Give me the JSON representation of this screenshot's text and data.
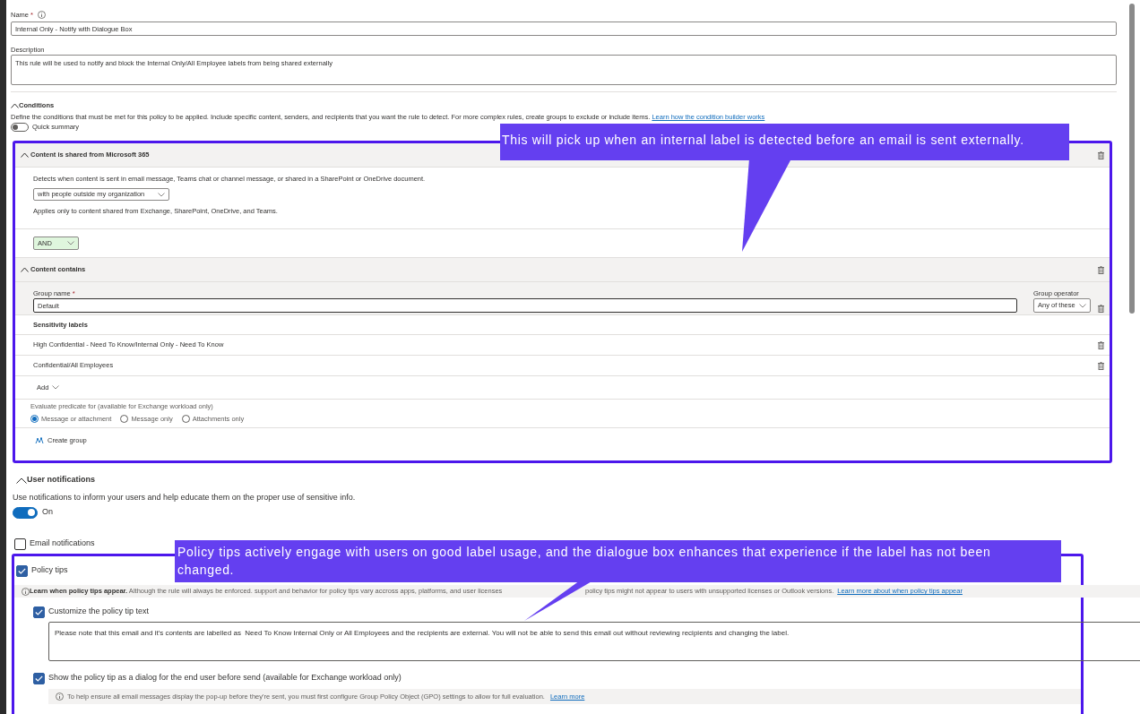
{
  "rule": {
    "name_label": "Name",
    "name_required": "*",
    "name_value": "Internal Only - Notify with Dialogue Box",
    "description_label": "Description",
    "description_value": "This rule will be used to notify and block the Internal Only/All Employee labels from being shared externally"
  },
  "conditions": {
    "title": "Conditions",
    "expanded": true,
    "text": "Define the conditions that must be met for this policy to be applied. Include specific content, senders, and recipients that you want the rule to detect. For more complex rules, create groups to exclude or include items.",
    "link": "Learn how the condition builder works",
    "quick_summary": {
      "label": "Quick summary",
      "on": false
    }
  },
  "shared_condition": {
    "title": "Content is shared from Microsoft 365",
    "expanded": true,
    "text": "Detects when content is sent in email message, Teams chat or channel message, or shared in a SharePoint or OneDrive document.",
    "dropdown": "with people outside my organization",
    "note": "Applies only to content shared from Exchange, SharePoint, OneDrive, and Teams."
  },
  "operator": "AND",
  "content_contains": {
    "title": "Content contains",
    "expanded": true,
    "group_name_label": "Group name",
    "group_name_required": "*",
    "group_name": "Default",
    "group_operator_label": "Group operator",
    "group_operator": "Any of these",
    "labels_title": "Sensitivity labels",
    "labels": [
      "High Confidential - Need To Know/Internal Only - Need To Know",
      "Confidential/All Employees"
    ],
    "add": "Add",
    "evaluate_label": "Evaluate predicate for (available for Exchange workload only)",
    "evaluate_options": [
      {
        "label": "Message or attachment",
        "selected": true
      },
      {
        "label": "Message only",
        "selected": false
      },
      {
        "label": "Attachments only",
        "selected": false
      }
    ],
    "create_group": "Create group"
  },
  "user_notifications": {
    "title": "User notifications",
    "expanded": true,
    "text": "Use notifications to inform your users and help educate them on the proper use of sensitive info.",
    "toggle": {
      "label": "On",
      "on": true
    }
  },
  "email_notifications": {
    "label": "Email notifications",
    "checked": false
  },
  "policy_tips": {
    "label": "Policy tips",
    "checked": true,
    "info": "**Learn when policy tips appear.** Although the rule will always be enforced. support and behavior for policy tips vary accross apps, platforms, and user licenses",
    "info_after": "policy tips might not appear to users with unsupported licenses or Outlook versions.",
    "info_link": "Learn more about when policy tips appear",
    "customize": {
      "label": "Customize the policy tip text",
      "checked": true
    },
    "tip_text": "Please note that this email and it's contents are labelled as  Need To Know Internal Only or All Employees and the recipients are external. You will not be able to send this email out without reviewing recipients and changing the label.",
    "dialog": {
      "label": "Show the policy tip as a dialog for the end user before send (available for Exchange workload only)",
      "checked": true
    },
    "gpo_info": "To help ensure all email messages display the pop-up before they're sent, you must first configure Group Policy Object (GPO) settings to allow for full evaluation.",
    "gpo_link": "Learn more"
  },
  "annotations": [
    {
      "text": "This will pick up when an internal label is detected before an email is sent externally."
    },
    {
      "text": "Policy tips actively engage with users on good label usage, and the dialogue box enhances that experience if the label has not been changed."
    }
  ]
}
